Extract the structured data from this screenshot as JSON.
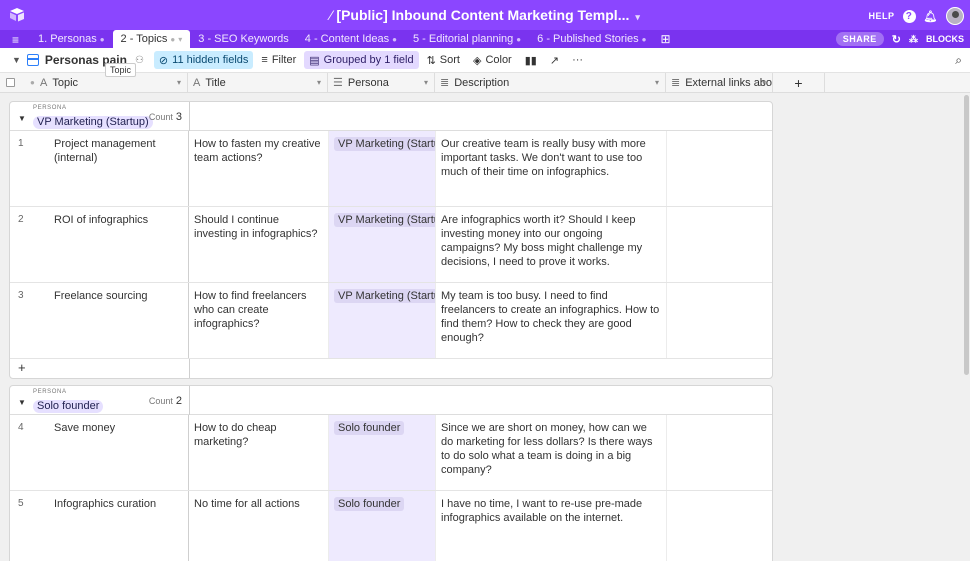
{
  "app": {
    "base_title": "[Public] Inbound Content Marketing Templ...",
    "help_label": "HELP",
    "share_label": "SHARE",
    "blocks_label": "BLOCKS"
  },
  "tabs": [
    {
      "label": "1. Personas",
      "active": false
    },
    {
      "label": "2 - Topics",
      "active": true
    },
    {
      "label": "3 - SEO Keywords",
      "active": false
    },
    {
      "label": "4 - Content Ideas",
      "active": false
    },
    {
      "label": "5 - Editorial planning",
      "active": false
    },
    {
      "label": "6 - Published Stories",
      "active": false
    }
  ],
  "toolbar": {
    "view_name": "Personas pain",
    "tooltip": "Topic",
    "hidden_fields": "11 hidden fields",
    "filter": "Filter",
    "grouped": "Grouped by 1 field",
    "sort": "Sort",
    "color": "Color"
  },
  "columns": {
    "topic": "Topic",
    "title": "Title",
    "persona": "Persona",
    "description": "Description",
    "links": "External links abo..."
  },
  "groups": [
    {
      "label": "PERSONA",
      "value": "VP Marketing (Startup)",
      "count_label": "Count",
      "count": "3",
      "rows": [
        {
          "num": "1",
          "topic": "Project management (internal)",
          "title": "How to fasten my creative team actions?",
          "persona": "VP Marketing (Startup)",
          "description": "Our creative team is really busy with more important tasks. We don't want to use too much of their time on infographics.",
          "links": ""
        },
        {
          "num": "2",
          "topic": "ROI of infographics",
          "title": "Should I continue investing in infographics?",
          "persona": "VP Marketing (Startup)",
          "description": "Are infographics worth it? Should I keep investing money into our ongoing campaigns? My boss might challenge my decisions, I need to prove it works.",
          "links": ""
        },
        {
          "num": "3",
          "topic": "Freelance sourcing",
          "title": "How to find freelancers who can create infographics?",
          "persona": "VP Marketing (Startup)",
          "description": "My team is too busy. I need to find freelancers to create an infographics. How to find them? How to check they are good enough?",
          "links": ""
        }
      ]
    },
    {
      "label": "PERSONA",
      "value": "Solo founder",
      "count_label": "Count",
      "count": "2",
      "rows": [
        {
          "num": "4",
          "topic": "Save money",
          "title": "How to do cheap marketing?",
          "persona": "Solo founder",
          "description": "Since we are short on money, how can we do marketing for less dollars? Is there ways to do solo what a team is doing in a big company?",
          "links": ""
        },
        {
          "num": "5",
          "topic": "Infographics curation",
          "title": "No time for all actions",
          "persona": "Solo founder",
          "description": "I have no time, I want to re-use pre-made infographics available on the internet.",
          "links": ""
        }
      ]
    }
  ],
  "colors": {
    "brand": "#8b46ff",
    "tabbar": "#7a33ef",
    "persona_bg": "#eeeafe",
    "hidden_btn": "#c9ecff",
    "group_btn": "#e3d9ff"
  }
}
